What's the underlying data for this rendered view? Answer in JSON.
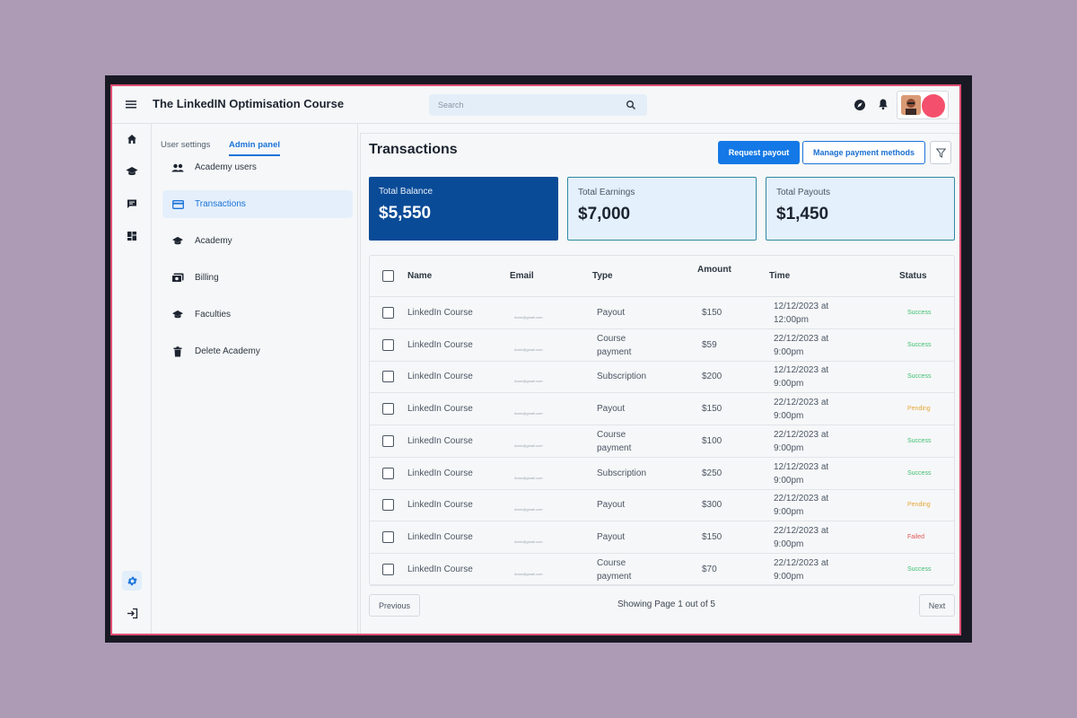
{
  "header": {
    "title": "The LinkedIN Optimisation Course",
    "search_placeholder": "Search"
  },
  "rail": {
    "icons": [
      "home-icon",
      "graduation-cap-icon",
      "chat-icon",
      "dashboard-icon",
      "gear-icon",
      "logout-icon"
    ],
    "active": "gear-icon"
  },
  "panel": {
    "tabs": [
      {
        "label": "User settings",
        "active": false
      },
      {
        "label": "Admin panel",
        "active": true
      }
    ],
    "items": [
      {
        "label": "Academy users",
        "icon": "users-icon",
        "active": false
      },
      {
        "label": "Transactions",
        "icon": "credit-card-icon",
        "active": true
      },
      {
        "label": "Academy",
        "icon": "graduation-cap-icon",
        "active": false
      },
      {
        "label": "Billing",
        "icon": "billing-icon",
        "active": false
      },
      {
        "label": "Faculties",
        "icon": "graduation-cap-icon",
        "active": false
      },
      {
        "label": "Delete Academy",
        "icon": "trash-icon",
        "active": false
      }
    ]
  },
  "main": {
    "title": "Transactions",
    "request_payout": "Request payout",
    "manage_payment": "Manage payment methods"
  },
  "cards": [
    {
      "label": "Total Balance",
      "value": "$5,550"
    },
    {
      "label": "Total Earnings",
      "value": "$7,000"
    },
    {
      "label": "Total Payouts",
      "value": "$1,450"
    }
  ],
  "table": {
    "headers": {
      "name": "Name",
      "email": "Email",
      "type": "Type",
      "amount": "Amount",
      "time": "Time",
      "status": "Status"
    },
    "rows": [
      {
        "name": "LinkedIn Course",
        "email": "Anne@gmail.com",
        "type": "Payout",
        "amount": "$150",
        "time": "12/12/2023 at 12:00pm",
        "status": "Success"
      },
      {
        "name": "LinkedIn Course",
        "email": "Anne@gmail.com",
        "type": "Course payment",
        "amount": "$59",
        "time": "22/12/2023 at 9:00pm",
        "status": "Success"
      },
      {
        "name": "LinkedIn Course",
        "email": "Anne@gmail.com",
        "type": "Subscription",
        "amount": "$200",
        "time": "12/12/2023 at 9:00pm",
        "status": "Success"
      },
      {
        "name": "LinkedIn Course",
        "email": "Anne@gmail.com",
        "type": "Payout",
        "amount": "$150",
        "time": "22/12/2023 at 9:00pm",
        "status": "Pending"
      },
      {
        "name": "LinkedIn Course",
        "email": "Anne@gmail.com",
        "type": "Course payment",
        "amount": "$100",
        "time": "22/12/2023 at 9:00pm",
        "status": "Success"
      },
      {
        "name": "LinkedIn Course",
        "email": "Anne@gmail.com",
        "type": "Subscription",
        "amount": "$250",
        "time": "12/12/2023 at 9:00pm",
        "status": "Success"
      },
      {
        "name": "LinkedIn Course",
        "email": "Anne@gmail.com",
        "type": "Payout",
        "amount": "$300",
        "time": "22/12/2023 at 9:00pm",
        "status": "Pending"
      },
      {
        "name": "LinkedIn Course",
        "email": "Anne@gmail.com",
        "type": "Payout",
        "amount": "$150",
        "time": "22/12/2023 at 9:00pm",
        "status": "Failed"
      },
      {
        "name": "LinkedIn Course",
        "email": "Anne@gmail.com",
        "type": "Course payment",
        "amount": "$70",
        "time": "22/12/2023 at 9:00pm",
        "status": "Success"
      }
    ]
  },
  "pagination": {
    "previous": "Previous",
    "next": "Next",
    "summary": "Showing Page 1 out of 5"
  },
  "colors": {
    "accent": "#1479e6",
    "balance_card": "#0a4b97",
    "success": "#3fbf72",
    "pending": "#e6a83a",
    "failed": "#e25a5a",
    "frame": "#e04f72",
    "backdrop": "#ad9bb6"
  }
}
